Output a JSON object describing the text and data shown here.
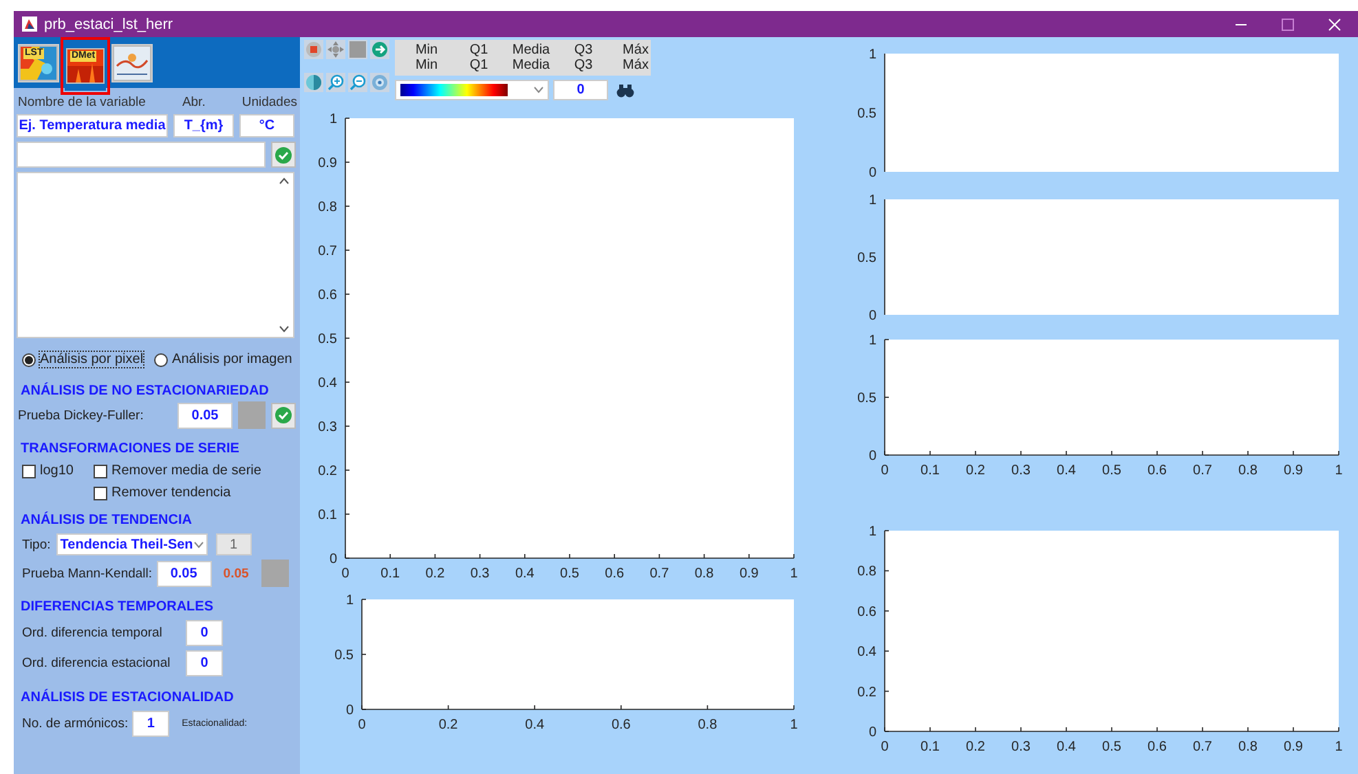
{
  "window": {
    "title": "prb_estaci_lst_herr"
  },
  "image_toolbar": [
    {
      "kind": "map",
      "label": "LST",
      "selected": false
    },
    {
      "kind": "heat",
      "label": "DMet",
      "selected": true
    },
    {
      "kind": "chart",
      "selected": false
    }
  ],
  "plot_toolbar": [
    {
      "kind": "stop"
    },
    {
      "kind": "pan"
    },
    {
      "kind": "blank"
    },
    {
      "kind": "next"
    },
    {
      "kind": "contrast"
    },
    {
      "kind": "zoom-in"
    },
    {
      "kind": "zoom-out"
    },
    {
      "kind": "target"
    }
  ],
  "stats": {
    "rows": [
      [
        "Min",
        "Q1",
        "Media",
        "Q3",
        "Máx"
      ],
      [
        "Min",
        "Q1",
        "Media",
        "Q3",
        "Máx"
      ]
    ]
  },
  "colormap": {
    "kind": "jet"
  },
  "level_field": {
    "value": "0"
  },
  "variable": {
    "headers": [
      "Nombre de la variable",
      "Abr.",
      "Unidades"
    ],
    "name": "Ej. Temperatura media",
    "abbr": "T_{m}",
    "units": "°C"
  },
  "analysis_mode": [
    {
      "label": "Análisis por pixel",
      "selected": true
    },
    {
      "label": "Análisis por imagen",
      "selected": false
    }
  ],
  "non_stationarity": {
    "heading": "ANÁLISIS DE NO ESTACIONARIEDAD",
    "label": "Prueba Dickey-Fuller:",
    "value": "0.05"
  },
  "transformations": {
    "heading": "TRANSFORMACIONES DE SERIE",
    "options": [
      {
        "label": "log10",
        "checked": false
      },
      {
        "label": "Remover media de serie",
        "checked": false
      },
      {
        "label": "Remover tendencia",
        "checked": false
      }
    ]
  },
  "trend": {
    "heading": "ANÁLISIS DE TENDENCIA",
    "type_label": "Tipo:",
    "type_value": "Tendencia Theil-Sen",
    "order": "1",
    "test_label": "Prueba Mann-Kendall:",
    "test_value": "0.05",
    "result": "0.05"
  },
  "differences": {
    "heading": "DIFERENCIAS TEMPORALES",
    "rows": [
      {
        "label": "Ord. diferencia temporal",
        "value": "0"
      },
      {
        "label": "Ord. diferencia estacional",
        "value": "0"
      }
    ]
  },
  "seasonality": {
    "heading": "ANÁLISIS DE ESTACIONALIDAD",
    "label": "No. de armónicos:",
    "value": "1",
    "note": "Estacionalidad:"
  },
  "charts": [
    {
      "chart_data": {
        "type": "line",
        "xlim": [
          0,
          1
        ],
        "ylim": [
          0,
          1
        ],
        "xticks": [
          0,
          0.1,
          0.2,
          0.3,
          0.4,
          0.5,
          0.6,
          0.7,
          0.8,
          0.9,
          1
        ],
        "yticks": [
          0,
          0.1,
          0.2,
          0.3,
          0.4,
          0.5,
          0.6,
          0.7,
          0.8,
          0.9,
          1
        ]
      }
    },
    {
      "chart_data": {
        "type": "line",
        "xlim": [
          0,
          1
        ],
        "ylim": [
          0,
          1
        ],
        "xticks": [
          0,
          0.2,
          0.4,
          0.6,
          0.8,
          1
        ],
        "yticks": [
          0,
          0.5,
          1
        ]
      }
    },
    {
      "axis_labels": [
        "1",
        "0.5",
        "0"
      ]
    },
    {
      "axis_labels": [
        "1",
        "0.5",
        "0"
      ]
    },
    {
      "chart_data": {
        "type": "line",
        "xlim": [
          0,
          1
        ],
        "ylim": [
          0,
          1
        ],
        "xticks": [
          0,
          0.1,
          0.2,
          0.3,
          0.4,
          0.5,
          0.6,
          0.7,
          0.8,
          0.9,
          1
        ],
        "yticks": [
          0,
          0.5,
          1
        ]
      }
    },
    {
      "chart_data": {
        "type": "line",
        "xlim": [
          0,
          1
        ],
        "ylim": [
          0,
          1
        ],
        "xticks": [
          0,
          0.1,
          0.2,
          0.3,
          0.4,
          0.5,
          0.6,
          0.7,
          0.8,
          0.9,
          1
        ],
        "yticks": [
          0,
          0.2,
          0.4,
          0.6,
          0.8,
          1
        ]
      }
    }
  ]
}
